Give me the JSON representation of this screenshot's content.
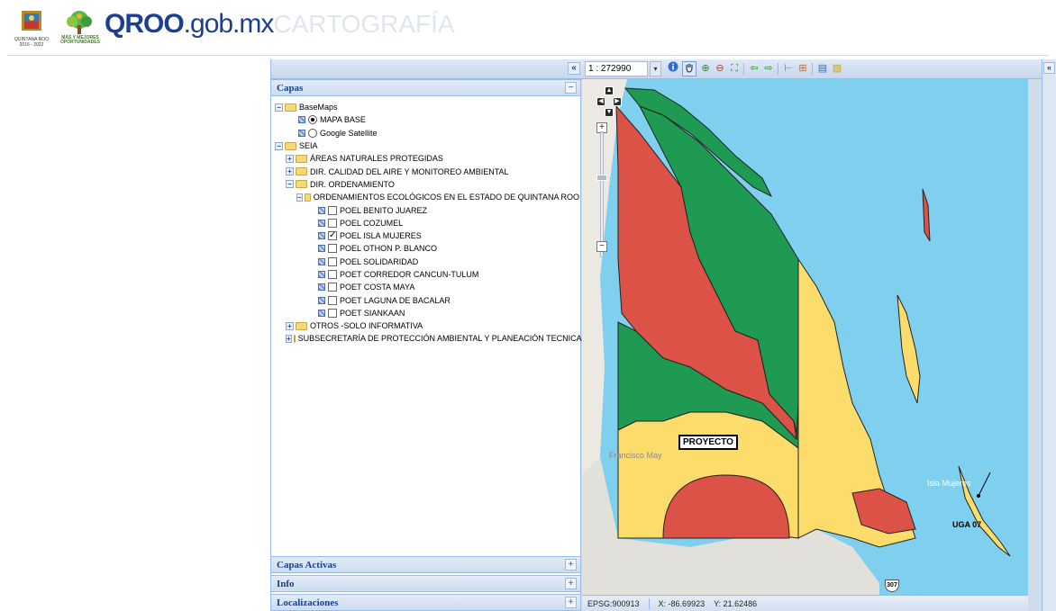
{
  "header": {
    "brand_strong": "QROO",
    "brand_domain": ".gob.mx",
    "brand_ghost": "CARTOGRAFÍA",
    "logo_state_caption": "QUINTANA ROO",
    "logo_state_years": "2016 - 2022",
    "logo_tree_caption_1": "MÁS Y MEJORES",
    "logo_tree_caption_2": "OPORTUNIDADES"
  },
  "toolbar": {
    "collapse_glyph": "«",
    "scale_value": "1 : 272990",
    "dropdown_glyph": "▾"
  },
  "right_rail": {
    "collapse_glyph": "«"
  },
  "panels": {
    "capas": {
      "title": "Capas",
      "tool": "−"
    },
    "capas_activas": {
      "title": "Capas Activas",
      "tool": "+"
    },
    "info": {
      "title": "Info",
      "tool": "+"
    },
    "localizaciones": {
      "title": "Localizaciones",
      "tool": "+"
    }
  },
  "tree": {
    "basemaps": "BaseMaps",
    "mapa_base": "MAPA BASE",
    "google_satellite": "Google Satellite",
    "seia": "SEIA",
    "areas_naturales": "ÁREAS NATURALES PROTEGIDAS",
    "dir_calidad": "DIR. CALIDAD DEL AIRE Y MONITOREO AMBIENTAL",
    "dir_ordenamiento": "DIR. ORDENAMIENTO",
    "ordenamientos": "ORDENAMIENTOS ECOLÓGICOS EN EL ESTADO DE QUINTANA ROO",
    "layers": [
      {
        "label": "POEL BENITO JUAREZ",
        "checked": false
      },
      {
        "label": "POEL COZUMEL",
        "checked": false
      },
      {
        "label": "POEL ISLA MUJERES",
        "checked": true
      },
      {
        "label": "POEL OTHON P. BLANCO",
        "checked": false
      },
      {
        "label": "POEL SOLIDARIDAD",
        "checked": false
      },
      {
        "label": "POET CORREDOR CANCUN-TULUM",
        "checked": false
      },
      {
        "label": "POET COSTA MAYA",
        "checked": false
      },
      {
        "label": "POET LAGUNA DE BACALAR",
        "checked": false
      },
      {
        "label": "POET SIANKAAN",
        "checked": false
      }
    ],
    "otros": "OTROS -SOLO INFORMATIVA",
    "subsecretaria": "SUBSECRETARÍA DE PROTECCIÓN AMBIENTAL Y PLANEACIÓN TECNICA"
  },
  "map": {
    "label_proyecto": "PROYECTO",
    "label_uga": "UGA 07",
    "town_isla": "Isla Mujeres",
    "town_francisco": "Francisco May",
    "road_shield": "307",
    "colors": {
      "red": "#dc5246",
      "green": "#1f9a52",
      "yellow": "#fcdc6a",
      "water": "#7fd0ef",
      "land": "#ece9e2"
    }
  },
  "status": {
    "epsg": "EPSG:900913",
    "x": "X: -86.69923",
    "y": "Y: 21.62486"
  }
}
